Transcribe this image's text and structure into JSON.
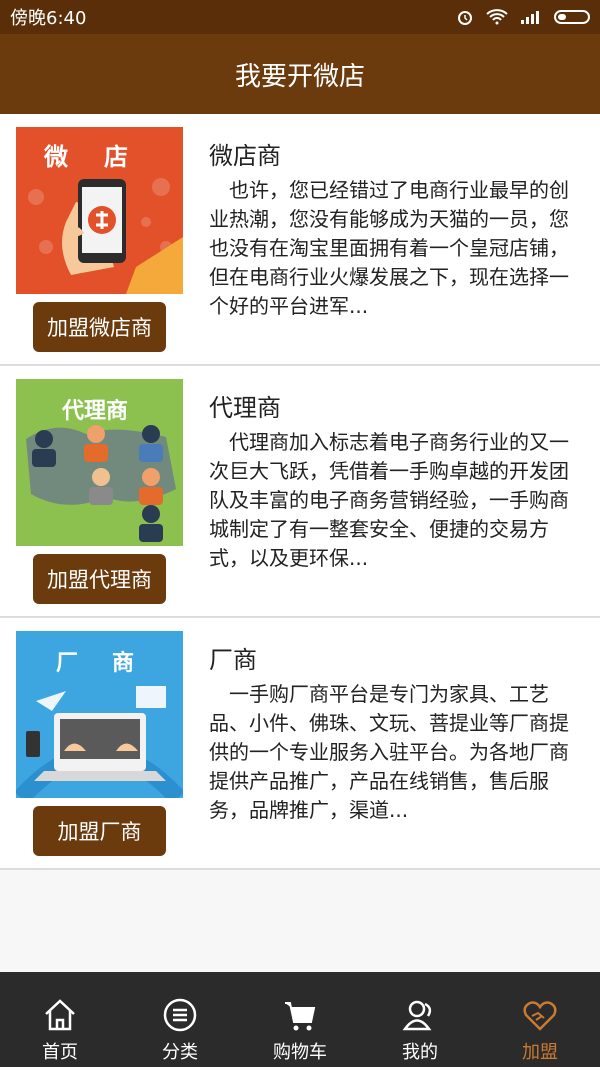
{
  "status_bar": {
    "time": "傍晚6:40"
  },
  "header": {
    "title": "我要开微店"
  },
  "items": [
    {
      "title": "微店商",
      "image_caption": "微　店",
      "button": "加盟微店商",
      "description": "　也许，您已经错过了电商行业最早的创业热潮，您没有能够成为天猫的一员，您也没有在淘宝里面拥有着一个皇冠店铺，但在电商行业火爆发展之下，现在选择一个好的平台进军..."
    },
    {
      "title": "代理商",
      "image_caption": "代理商",
      "button": "加盟代理商",
      "description": "　代理商加入标志着电子商务行业的又一次巨大飞跃，凭借着一手购卓越的开发团队及丰富的电子商务营销经验，一手购商城制定了有一整套安全、便捷的交易方式，以及更环保..."
    },
    {
      "title": "厂商",
      "image_caption": "厂　商",
      "button": "加盟厂商",
      "description": "　一手购厂商平台是专门为家具、工艺品、小件、佛珠、文玩、菩提业等厂商提供的一个专业服务入驻平台。为各地厂商提供产品推广，产品在线销售，售后服务，品牌推广，渠道..."
    }
  ],
  "tabs": [
    {
      "label": "首页",
      "icon": "home-icon"
    },
    {
      "label": "分类",
      "icon": "category-icon"
    },
    {
      "label": "购物车",
      "icon": "cart-icon"
    },
    {
      "label": "我的",
      "icon": "user-icon"
    },
    {
      "label": "加盟",
      "icon": "handshake-heart-icon",
      "active": true
    }
  ],
  "colors": {
    "header": "#6b3a0d",
    "status": "#5a2e08",
    "accent": "#c97a33",
    "tabbar": "#2b2b2b"
  }
}
